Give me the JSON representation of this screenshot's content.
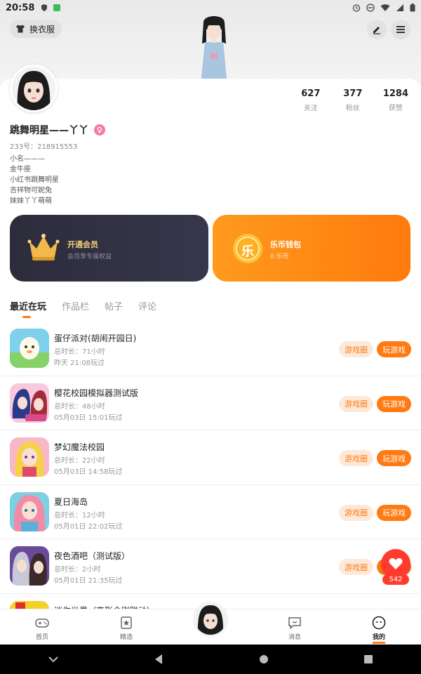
{
  "status_bar": {
    "time": "20:58"
  },
  "header": {
    "wardrobe_label": "换衣服"
  },
  "profile": {
    "name": "跳舞明星——丫丫",
    "uid": "233号：218915553",
    "bio": [
      "小名———",
      "金牛座",
      "小红书跳舞明星",
      "吉祥物可妮兔",
      "妹妹丫丫萌萌"
    ]
  },
  "stats": [
    {
      "num": "627",
      "label": "关注"
    },
    {
      "num": "377",
      "label": "粉丝"
    },
    {
      "num": "1284",
      "label": "获赞"
    }
  ],
  "vip": {
    "title": "开通会员",
    "subtitle": "会员享专属权益"
  },
  "wallet": {
    "title": "乐币钱包",
    "subtitle": "0 乐币",
    "icon_char": "乐"
  },
  "tabs": [
    "最近在玩",
    "作品栏",
    "帖子",
    "评论"
  ],
  "games": [
    {
      "title": "蛋仔派对(胡闹开园日)",
      "duration": "总时长：71小时",
      "last": "昨天 21:08玩过",
      "btn_circle": "游戏圈",
      "btn_play": "玩游戏"
    },
    {
      "title": "樱花校园模拟器测试版",
      "duration": "总时长：48小时",
      "last": "05月03日 15:01玩过",
      "btn_circle": "游戏圈",
      "btn_play": "玩游戏"
    },
    {
      "title": "梦幻魔法校园",
      "duration": "总时长：22小时",
      "last": "05月03日 14:58玩过",
      "btn_circle": "游戏圈",
      "btn_play": "玩游戏"
    },
    {
      "title": "夏日海岛",
      "duration": "总时长：12小时",
      "last": "05月01日 22:02玩过",
      "btn_circle": "游戏圈",
      "btn_play": "玩游戏"
    },
    {
      "title": "夜色酒吧（测试版）",
      "duration": "总时长：2小时",
      "last": "05月01日 21:35玩过",
      "btn_circle": "游戏圈",
      "btn_play": "玩游戏"
    },
    {
      "title": "迷你世界（变形金刚联动）",
      "duration": "",
      "last": "",
      "btn_circle": "",
      "btn_play": ""
    }
  ],
  "fab": {
    "count": "542"
  },
  "nav": [
    "首页",
    "精选",
    "消息",
    "我的"
  ],
  "colors": {
    "accent": "#ff7a12",
    "vip_bg": "#2c2c3b",
    "like_red": "#ff3b30"
  }
}
